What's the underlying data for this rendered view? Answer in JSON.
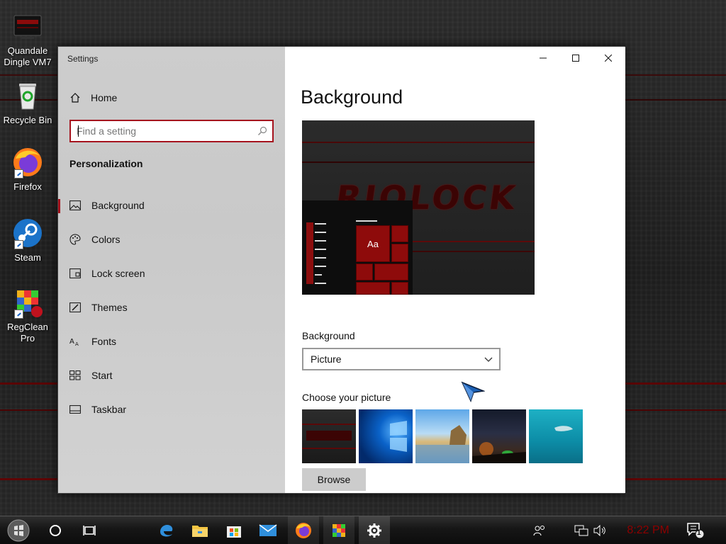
{
  "desktop": {
    "icons": [
      {
        "label": "Quandale Dingle VM7",
        "icon": "computer-icon"
      },
      {
        "label": "Recycle Bin",
        "icon": "recycle-bin-icon"
      },
      {
        "label": "Firefox",
        "icon": "firefox-icon"
      },
      {
        "label": "Steam",
        "icon": "steam-icon"
      },
      {
        "label": "RegClean Pro",
        "icon": "regclean-icon"
      }
    ]
  },
  "window": {
    "app_title": "Settings",
    "nav": {
      "home": "Home",
      "search_placeholder": "Find a setting",
      "section_title": "Personalization",
      "items": [
        {
          "label": "Background",
          "icon": "picture-icon",
          "active": true
        },
        {
          "label": "Colors",
          "icon": "palette-icon",
          "active": false
        },
        {
          "label": "Lock screen",
          "icon": "lock-screen-icon",
          "active": false
        },
        {
          "label": "Themes",
          "icon": "themes-icon",
          "active": false
        },
        {
          "label": "Fonts",
          "icon": "fonts-icon",
          "active": false
        },
        {
          "label": "Start",
          "icon": "start-icon",
          "active": false
        },
        {
          "label": "Taskbar",
          "icon": "taskbar-icon",
          "active": false
        }
      ]
    },
    "content": {
      "page_title": "Background",
      "preview": {
        "wallpaper_text": "RIOLOCK",
        "tile_label": "Aa"
      },
      "background_label": "Background",
      "background_value": "Picture",
      "choose_picture_label": "Choose your picture",
      "browse_label": "Browse"
    }
  },
  "taskbar": {
    "clock": "8:22 PM",
    "notification_count": "1",
    "apps": [
      "start-icon",
      "cortana-icon",
      "task-view-icon",
      "edge-icon",
      "file-explorer-icon",
      "store-icon",
      "mail-icon",
      "firefox-icon",
      "regclean-icon",
      "settings-icon"
    ]
  },
  "colors": {
    "accent": "#a5131e",
    "wallpaper_red": "#6d0606",
    "clock": "#8d0000"
  }
}
